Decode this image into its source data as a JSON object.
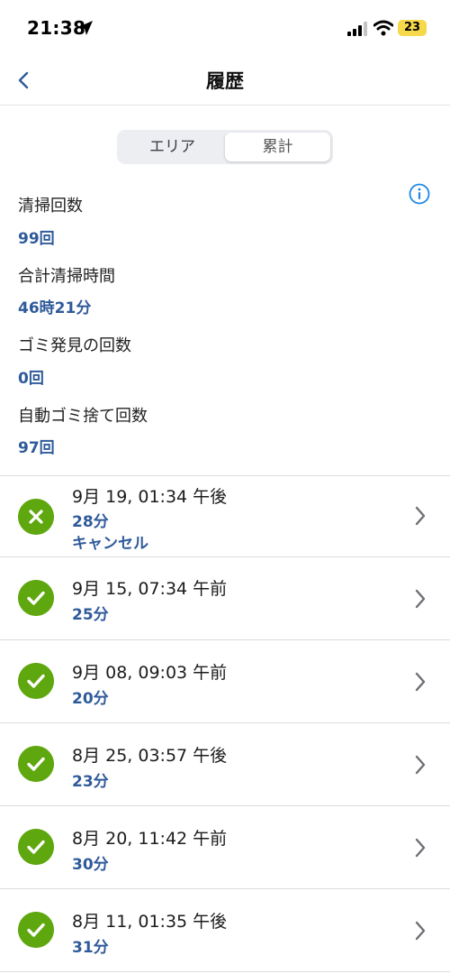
{
  "status_bar": {
    "time": "21:38",
    "battery": "23"
  },
  "nav": {
    "title": "履歴"
  },
  "segmented": {
    "left": "エリア",
    "right": "累計"
  },
  "stats": [
    {
      "label": "清掃回数",
      "value": "99回"
    },
    {
      "label": "合計清掃時間",
      "value": "46時21分"
    },
    {
      "label": "ゴミ発見の回数",
      "value": "0回"
    },
    {
      "label": "自動ゴミ捨て回数",
      "value": "97回"
    }
  ],
  "history": [
    {
      "date": "9月 19, 01:34 午後",
      "duration": "28分",
      "note": "キャンセル",
      "status": "cancelled",
      "status_icon": "x-icon"
    },
    {
      "date": "9月 15, 07:34 午前",
      "duration": "25分",
      "status": "completed",
      "status_icon": "check-icon"
    },
    {
      "date": "9月 08, 09:03 午前",
      "duration": "20分",
      "status": "completed",
      "status_icon": "check-icon"
    },
    {
      "date": "8月 25, 03:57 午後",
      "duration": "23分",
      "status": "completed",
      "status_icon": "check-icon"
    },
    {
      "date": "8月 20, 11:42 午前",
      "duration": "30分",
      "status": "completed",
      "status_icon": "check-icon"
    },
    {
      "date": "8月 11, 01:35 午後",
      "duration": "31分",
      "status": "completed",
      "status_icon": "check-icon"
    }
  ],
  "colors": {
    "accent": "#2f5a9a",
    "status_green": "#5fa70f",
    "info_blue": "#1e88e5"
  }
}
